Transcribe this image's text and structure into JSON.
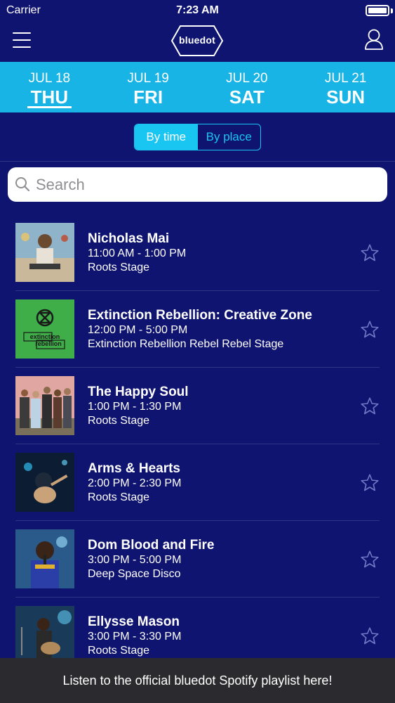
{
  "status_bar": {
    "carrier": "Carrier",
    "time": "7:23 AM"
  },
  "nav": {
    "logo_text": "bluedot"
  },
  "days": [
    {
      "date": "JUL 18",
      "name": "THU",
      "active": true
    },
    {
      "date": "JUL 19",
      "name": "FRI",
      "active": false
    },
    {
      "date": "JUL 20",
      "name": "SAT",
      "active": false
    },
    {
      "date": "JUL 21",
      "name": "SUN",
      "active": false
    }
  ],
  "segment": {
    "by_time": "By time",
    "by_place": "By place",
    "selected": "by_time"
  },
  "search": {
    "placeholder": "Search"
  },
  "events": [
    {
      "name": "Nicholas Mai",
      "time": "11:00 AM - 1:00 PM",
      "stage": "Roots Stage",
      "starred": false
    },
    {
      "name": "Extinction Rebellion: Creative Zone",
      "time": "12:00 PM - 5:00 PM",
      "stage": "Extinction Rebellion Rebel Rebel Stage",
      "starred": false,
      "thumb_text_1": "extinction",
      "thumb_text_2": "rebellion"
    },
    {
      "name": "The Happy Soul",
      "time": "1:00 PM - 1:30 PM",
      "stage": "Roots Stage",
      "starred": false
    },
    {
      "name": "Arms & Hearts",
      "time": "2:00 PM - 2:30 PM",
      "stage": "Roots Stage",
      "starred": false
    },
    {
      "name": "Dom Blood and Fire",
      "time": "3:00 PM - 5:00 PM",
      "stage": "Deep Space Disco",
      "starred": false
    },
    {
      "name": "Ellysse Mason",
      "time": "3:00 PM - 3:30 PM",
      "stage": "Roots Stage",
      "starred": false
    }
  ],
  "footer": {
    "text": "Listen to the official bluedot Spotify playlist here!"
  },
  "colors": {
    "background": "#0f1470",
    "day_bar": "#18b4e6",
    "accent": "#19c6f1",
    "footer": "#2b2b2f"
  }
}
